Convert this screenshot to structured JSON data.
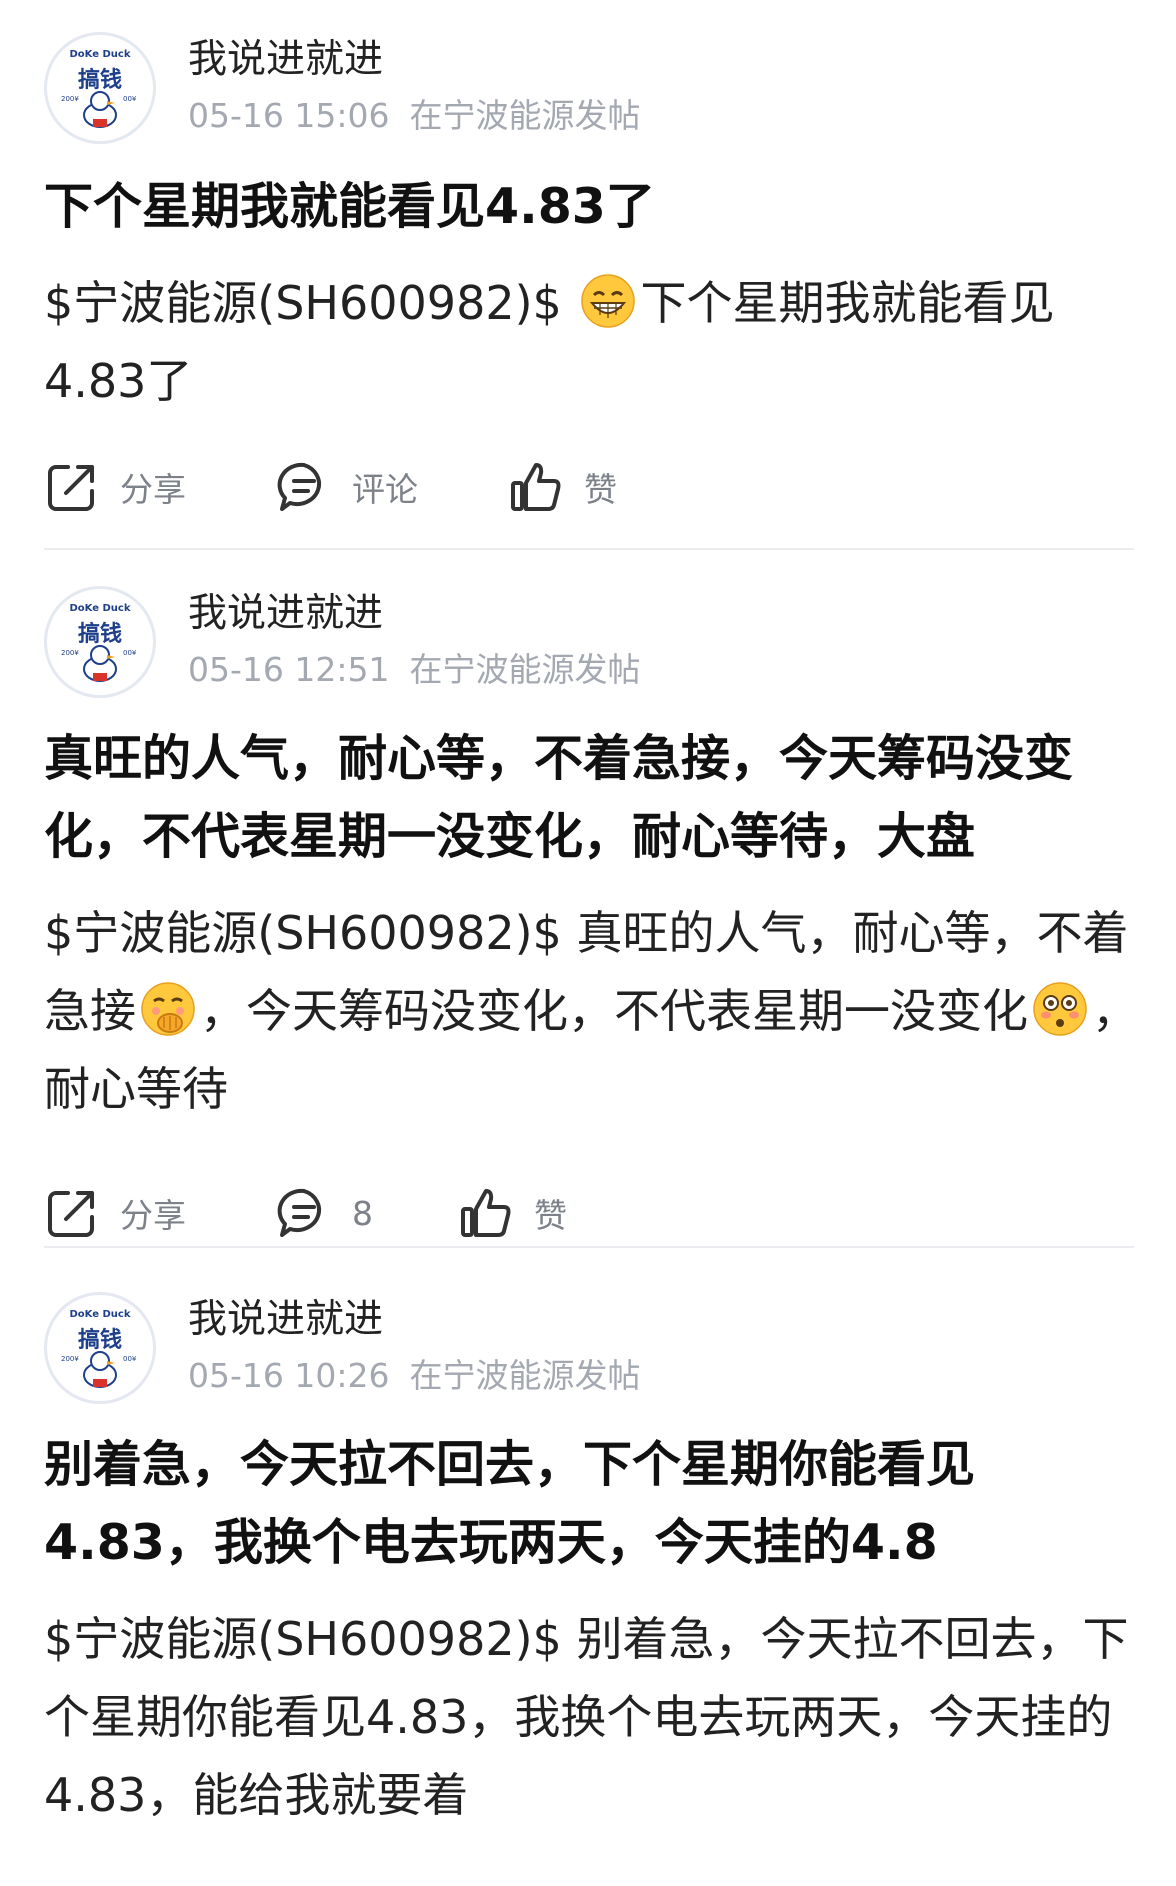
{
  "posts": [
    {
      "author": "我说进就进",
      "timestamp": "05-16 15:06",
      "location": "在宁波能源发帖",
      "title": "下个星期我就能看见4.83了",
      "body_stock": "$宁波能源(SH600982)$",
      "body_parts": [
        "",
        "下个星期我就能看见4.83了"
      ],
      "emojis": [
        "grin-emoji"
      ],
      "actions": {
        "share": "分享",
        "comment": "评论",
        "like": "赞"
      }
    },
    {
      "author": "我说进就进",
      "timestamp": "05-16 12:51",
      "location": "在宁波能源发帖",
      "title": "真旺的人气，耐心等，不着急接，今天筹码没变化，不代表星期一没变化，耐心等待，大盘",
      "body_stock": "$宁波能源(SH600982)$",
      "body_parts": [
        "真旺的人气，耐心等，不着急接",
        "，今天筹码没变化，不代表星期一没变化",
        "，耐心等待"
      ],
      "emojis": [
        "giggle-emoji",
        "flushed-emoji"
      ],
      "actions": {
        "share": "分享",
        "comment": "8",
        "like": "赞"
      }
    },
    {
      "author": "我说进就进",
      "timestamp": "05-16 10:26",
      "location": "在宁波能源发帖",
      "title": "别着急，今天拉不回去，下个星期你能看见4.83，我换个电去玩两天，今天挂的4.8",
      "body_stock": "$宁波能源(SH600982)$",
      "body_parts": [
        "别着急，今天拉不回去，下个星期你能看见4.83，我换个电去玩两天，今天挂的4.83，能给我就要着"
      ],
      "emojis": [],
      "actions": {
        "share": "分享",
        "comment": "评论",
        "like": "赞"
      }
    }
  ],
  "avatar": {
    "top_text": "DoKe Duck",
    "main_text": "搞钱",
    "side_left": "200¥",
    "side_right": "00¥"
  },
  "colors": {
    "meta": "#a3a8b1",
    "action_label": "#7d828a",
    "divider": "#ebedf0",
    "title": "#111111"
  }
}
